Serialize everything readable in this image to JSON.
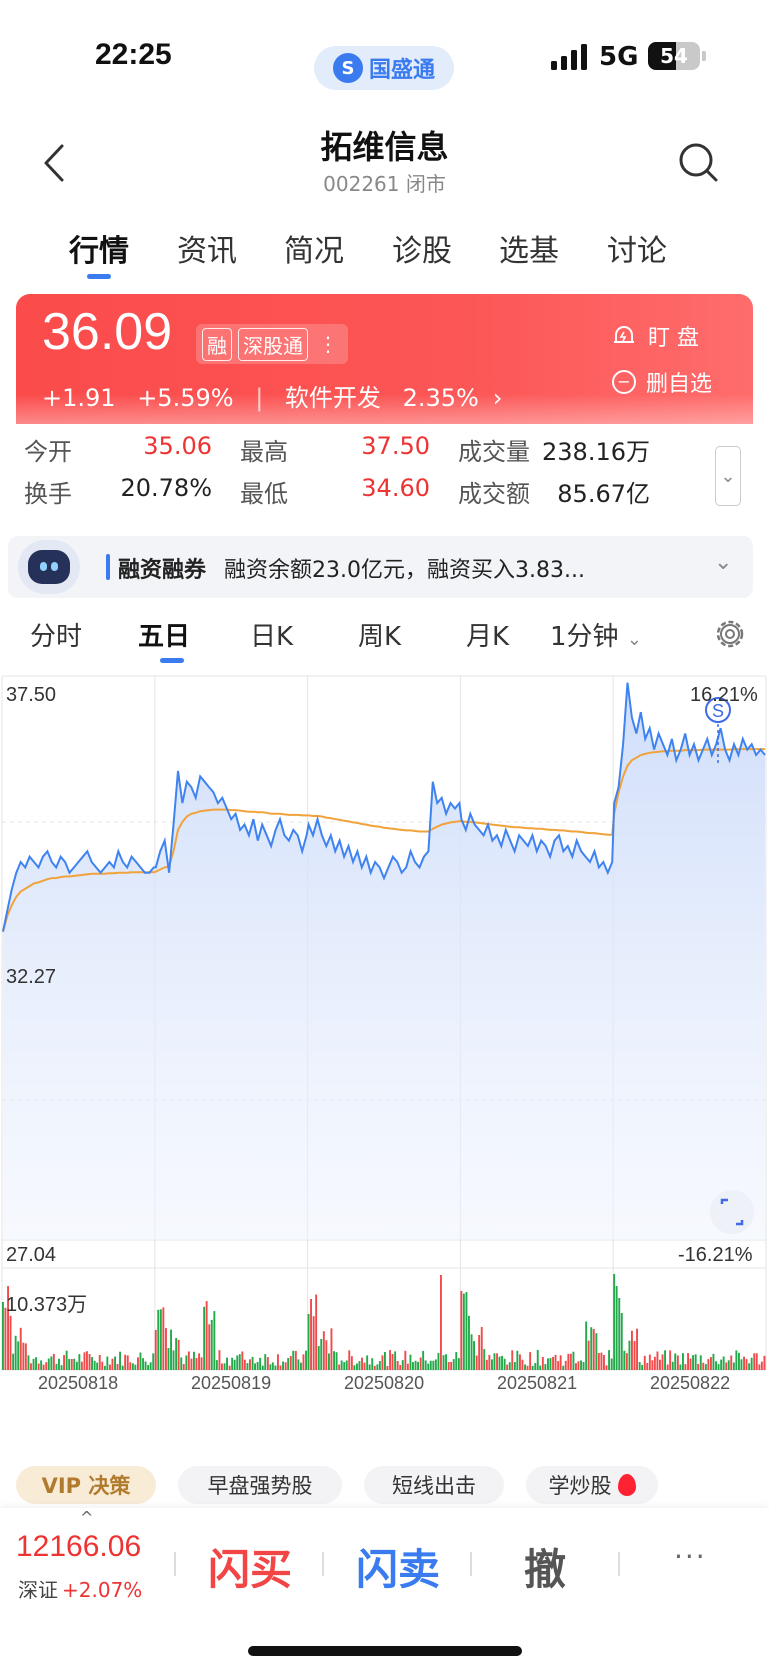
{
  "status_bar": {
    "time": "22:25",
    "app_pill": "国盛通",
    "network": "5G",
    "battery": "54"
  },
  "header": {
    "title": "拓维信息",
    "subtitle": "002261 闭市"
  },
  "tabs": [
    {
      "label": "行情",
      "active": true
    },
    {
      "label": "资讯"
    },
    {
      "label": "简况"
    },
    {
      "label": "诊股"
    },
    {
      "label": "选基"
    },
    {
      "label": "讨论"
    }
  ],
  "quote": {
    "price": "36.09",
    "badges": [
      "融",
      "深股通"
    ],
    "change": "+1.91",
    "change_pct": "+5.59%",
    "divider": "|",
    "sector": "软件开发",
    "sector_pct": "2.35%",
    "watch_label": "盯  盘",
    "unfav_label": "删自选",
    "color_up": "#fb4b4b"
  },
  "stats": [
    {
      "label": "今开",
      "value": "35.06",
      "red": true
    },
    {
      "label": "最高",
      "value": "37.50",
      "red": true
    },
    {
      "label": "成交量",
      "value": "238.16万",
      "red": false
    },
    {
      "label": "换手",
      "value": "20.78%",
      "red": false
    },
    {
      "label": "最低",
      "value": "34.60",
      "red": true
    },
    {
      "label": "成交额",
      "value": "85.67亿",
      "red": false
    }
  ],
  "margin": {
    "title": "融资融券",
    "text": "融资余额23.0亿元，融资买入3.83..."
  },
  "chart_tabs": [
    {
      "label": "分时"
    },
    {
      "label": "五日",
      "active": true
    },
    {
      "label": "日K"
    },
    {
      "label": "周K"
    },
    {
      "label": "月K"
    },
    {
      "label": "1分钟"
    }
  ],
  "chart_data": {
    "type": "line",
    "y_max_label": "37.50",
    "y_mid_label": "32.27",
    "y_min_label": "27.04",
    "pct_max_label": "16.21%",
    "pct_min_label": "-16.21%",
    "ylim": [
      27.04,
      37.5
    ],
    "volume_max_label": "10.373万",
    "days": [
      "20250818",
      "20250819",
      "20250820",
      "20250821",
      "20250822"
    ],
    "price_series": [
      [
        32.8,
        33.2,
        33.6,
        33.9,
        34.1,
        34.0,
        34.2,
        34.1,
        34.0,
        34.2,
        34.3,
        34.1,
        34.0,
        34.2,
        34.1,
        33.9,
        34.0,
        34.1,
        34.2,
        34.3,
        34.1,
        34.0,
        33.9,
        34.0,
        34.1,
        34.0,
        34.3,
        34.1,
        34.0,
        34.2,
        34.1,
        34.0,
        33.9,
        33.9,
        34.0
      ],
      [
        34.0,
        34.3,
        34.5,
        33.9,
        34.8,
        35.8,
        35.2,
        35.6,
        35.5,
        35.3,
        35.7,
        35.6,
        35.5,
        35.4,
        35.2,
        35.3,
        35.1,
        34.9,
        35.0,
        34.7,
        34.8,
        34.6,
        34.9,
        34.5,
        34.8,
        34.6,
        34.4,
        34.7,
        34.9,
        34.6,
        34.5,
        34.7,
        34.6,
        34.3,
        34.6
      ],
      [
        34.8,
        34.6,
        34.9,
        34.6,
        34.4,
        34.6,
        34.3,
        34.5,
        34.2,
        34.4,
        34.1,
        34.3,
        34.0,
        34.2,
        33.9,
        34.1,
        34.0,
        33.8,
        34.0,
        34.2,
        34.1,
        33.9,
        34.0,
        34.3,
        34.1,
        34.0,
        34.2,
        34.3,
        35.6,
        35.2,
        35.3,
        35.0,
        35.2,
        35.1,
        35.2
      ],
      [
        34.9,
        34.7,
        35.0,
        34.8,
        34.7,
        34.6,
        34.8,
        34.5,
        34.6,
        34.4,
        34.7,
        34.5,
        34.3,
        34.6,
        34.5,
        34.4,
        34.6,
        34.3,
        34.5,
        34.4,
        34.2,
        34.5,
        34.6,
        34.3,
        34.4,
        34.2,
        34.5,
        34.3,
        34.2,
        34.1,
        34.3,
        34.0,
        34.1,
        33.9,
        34.1
      ],
      [
        35.2,
        35.5,
        36.3,
        37.45,
        36.8,
        36.5,
        36.9,
        36.4,
        36.6,
        36.2,
        36.5,
        36.3,
        36.1,
        36.4,
        36.0,
        36.2,
        36.5,
        36.1,
        36.3,
        36.0,
        36.2,
        36.4,
        36.1,
        36.3,
        36.6,
        36.2,
        36.0,
        36.3,
        36.1,
        36.4,
        36.2,
        36.3,
        36.1,
        36.2,
        36.1
      ]
    ],
    "avg_series": [
      [
        32.8,
        33.1,
        33.3,
        33.45,
        33.55,
        33.6,
        33.65,
        33.7,
        33.72,
        33.75,
        33.78,
        33.8,
        33.8,
        33.82,
        33.83,
        33.83,
        33.84,
        33.85,
        33.86,
        33.87,
        33.88,
        33.88,
        33.88,
        33.88,
        33.89,
        33.89,
        33.9,
        33.9,
        33.9,
        33.91,
        33.91,
        33.91,
        33.91,
        33.91,
        33.91
      ],
      [
        33.92,
        33.96,
        34.0,
        34.02,
        34.3,
        34.7,
        34.85,
        34.95,
        35.0,
        35.02,
        35.05,
        35.06,
        35.07,
        35.08,
        35.08,
        35.08,
        35.08,
        35.07,
        35.07,
        35.06,
        35.05,
        35.04,
        35.04,
        35.03,
        35.03,
        35.02,
        35.0,
        35.0,
        35.0,
        34.99,
        34.98,
        34.98,
        34.98,
        34.97,
        34.97
      ],
      [
        34.97,
        34.96,
        34.96,
        34.95,
        34.93,
        34.92,
        34.9,
        34.89,
        34.87,
        34.86,
        34.84,
        34.83,
        34.81,
        34.8,
        34.78,
        34.77,
        34.76,
        34.74,
        34.73,
        34.72,
        34.71,
        34.7,
        34.69,
        34.69,
        34.68,
        34.67,
        34.67,
        34.67,
        34.72,
        34.76,
        34.8,
        34.82,
        34.84,
        34.85,
        34.86
      ],
      [
        34.86,
        34.85,
        34.85,
        34.84,
        34.83,
        34.82,
        34.81,
        34.8,
        34.79,
        34.78,
        34.77,
        34.76,
        34.75,
        34.75,
        34.74,
        34.73,
        34.73,
        34.72,
        34.72,
        34.71,
        34.7,
        34.7,
        34.69,
        34.69,
        34.68,
        34.67,
        34.67,
        34.66,
        34.65,
        34.64,
        34.64,
        34.63,
        34.62,
        34.61,
        34.61
      ],
      [
        35.0,
        35.4,
        35.7,
        35.9,
        36.0,
        36.05,
        36.1,
        36.12,
        36.14,
        36.15,
        36.16,
        36.17,
        36.17,
        36.18,
        36.18,
        36.18,
        36.19,
        36.19,
        36.19,
        36.19,
        36.2,
        36.2,
        36.2,
        36.2,
        36.2,
        36.2,
        36.2,
        36.21,
        36.21,
        36.21,
        36.21,
        36.21,
        36.21,
        36.21,
        36.21
      ]
    ],
    "price_color": "#3f83f0",
    "avg_color": "#f0a23b",
    "fill_color": "#d6e3fc",
    "vol_up_color": "#f04a4a",
    "vol_down_color": "#22a94a"
  },
  "features": [
    {
      "label": "VIP 决策",
      "vip": true
    },
    {
      "label": "早盘强势股"
    },
    {
      "label": "短线出击"
    },
    {
      "label": "学炒股"
    }
  ],
  "bottom": {
    "index_value": "12166.06",
    "index_name": "深证",
    "index_change": "+2.07%",
    "buy": "闪买",
    "sell": "闪卖",
    "cancel": "撤",
    "more": "···"
  }
}
